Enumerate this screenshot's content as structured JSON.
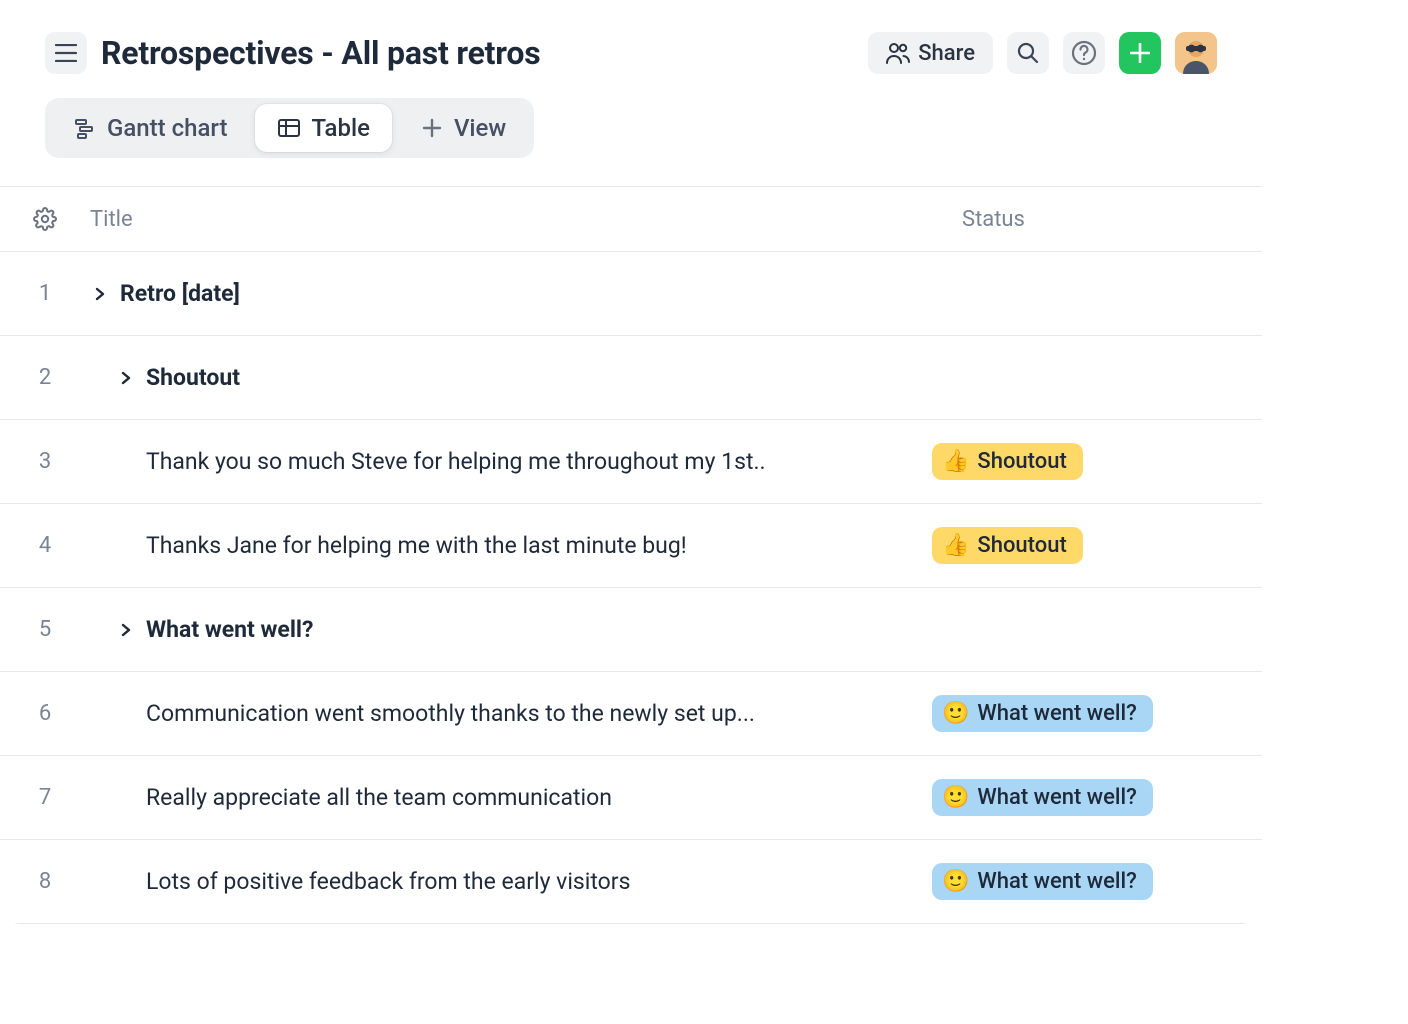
{
  "header": {
    "title": "Retrospectives - All past retros",
    "share_label": "Share"
  },
  "views": {
    "gantt": "Gantt chart",
    "table": "Table",
    "add_view": "View"
  },
  "columns": {
    "title": "Title",
    "status": "Status"
  },
  "status_labels": {
    "shoutout": "Shoutout",
    "well": "What went well?"
  },
  "status_emojis": {
    "shoutout": "👍",
    "well": "🙂"
  },
  "rows": [
    {
      "num": "1",
      "title": "Retro [date]",
      "bold": true,
      "indent": 0,
      "expand": true,
      "status": null
    },
    {
      "num": "2",
      "title": "Shoutout",
      "bold": true,
      "indent": 1,
      "expand": true,
      "status": null
    },
    {
      "num": "3",
      "title": "Thank you so much Steve for helping me throughout my 1st..",
      "bold": false,
      "indent": 2,
      "expand": false,
      "status": "shoutout"
    },
    {
      "num": "4",
      "title": "Thanks Jane for helping me with the last minute bug!",
      "bold": false,
      "indent": 2,
      "expand": false,
      "status": "shoutout"
    },
    {
      "num": "5",
      "title": "What went well?",
      "bold": true,
      "indent": 1,
      "expand": true,
      "status": null
    },
    {
      "num": "6",
      "title": "Communication went smoothly thanks to the newly set up...",
      "bold": false,
      "indent": 2,
      "expand": false,
      "status": "well"
    },
    {
      "num": "7",
      "title": "Really appreciate all the team communication",
      "bold": false,
      "indent": 2,
      "expand": false,
      "status": "well"
    },
    {
      "num": "8",
      "title": "Lots of positive feedback from the early visitors",
      "bold": false,
      "indent": 2,
      "expand": false,
      "status": "well"
    }
  ]
}
